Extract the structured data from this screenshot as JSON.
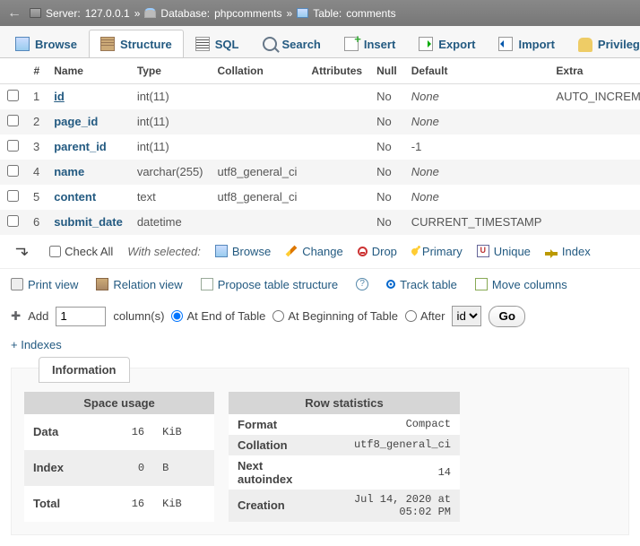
{
  "breadcrumb": {
    "back": "←",
    "server_lbl": "Server:",
    "server": "127.0.0.1",
    "sep": "»",
    "db_lbl": "Database:",
    "db": "phpcomments",
    "tb_lbl": "Table:",
    "tb": "comments"
  },
  "tabs": {
    "browse": "Browse",
    "structure": "Structure",
    "sql": "SQL",
    "search": "Search",
    "insert": "Insert",
    "export": "Export",
    "import": "Import",
    "privileges": "Privilege"
  },
  "hdr": {
    "num": "#",
    "name": "Name",
    "type": "Type",
    "coll": "Collation",
    "attr": "Attributes",
    "null": "Null",
    "def": "Default",
    "extra": "Extra"
  },
  "rows": [
    {
      "n": "1",
      "name": "id",
      "type": "int(11)",
      "coll": "",
      "attr": "",
      "null": "No",
      "def": "None",
      "def_none": true,
      "extra": "AUTO_INCREMENT",
      "u": true
    },
    {
      "n": "2",
      "name": "page_id",
      "type": "int(11)",
      "coll": "",
      "attr": "",
      "null": "No",
      "def": "None",
      "def_none": true,
      "extra": ""
    },
    {
      "n": "3",
      "name": "parent_id",
      "type": "int(11)",
      "coll": "",
      "attr": "",
      "null": "No",
      "def": "-1",
      "def_none": false,
      "extra": ""
    },
    {
      "n": "4",
      "name": "name",
      "type": "varchar(255)",
      "coll": "utf8_general_ci",
      "attr": "",
      "null": "No",
      "def": "None",
      "def_none": true,
      "extra": ""
    },
    {
      "n": "5",
      "name": "content",
      "type": "text",
      "coll": "utf8_general_ci",
      "attr": "",
      "null": "No",
      "def": "None",
      "def_none": true,
      "extra": ""
    },
    {
      "n": "6",
      "name": "submit_date",
      "type": "datetime",
      "coll": "",
      "attr": "",
      "null": "No",
      "def": "CURRENT_TIMESTAMP",
      "def_none": false,
      "extra": ""
    }
  ],
  "act": {
    "checkall": "Check All",
    "with": "With selected:",
    "browse": "Browse",
    "change": "Change",
    "drop": "Drop",
    "primary": "Primary",
    "unique": "Unique",
    "index": "Index",
    "u": "U"
  },
  "tool": {
    "print": "Print view",
    "rel": "Relation view",
    "prop": "Propose table structure",
    "help": "?",
    "track": "Track table",
    "move": "Move columns"
  },
  "add": {
    "icon": "➕",
    "add": "Add",
    "val": "1",
    "cols": "column(s)",
    "end": "At End of Table",
    "beg": "At Beginning of Table",
    "after": "After",
    "sel": "id",
    "go": "Go"
  },
  "idx_link": "+ Indexes",
  "info": {
    "title": "Information",
    "su": {
      "cap": "Space usage",
      "r": [
        [
          "Data",
          "16",
          "KiB"
        ],
        [
          "Index",
          "0",
          "B"
        ],
        [
          "Total",
          "16",
          "KiB"
        ]
      ]
    },
    "rs": {
      "cap": "Row statistics",
      "r": [
        [
          "Format",
          "Compact"
        ],
        [
          "Collation",
          "utf8_general_ci"
        ],
        [
          "Next autoindex",
          "14"
        ],
        [
          "Creation",
          "Jul 14, 2020 at 05:02 PM"
        ]
      ]
    }
  }
}
